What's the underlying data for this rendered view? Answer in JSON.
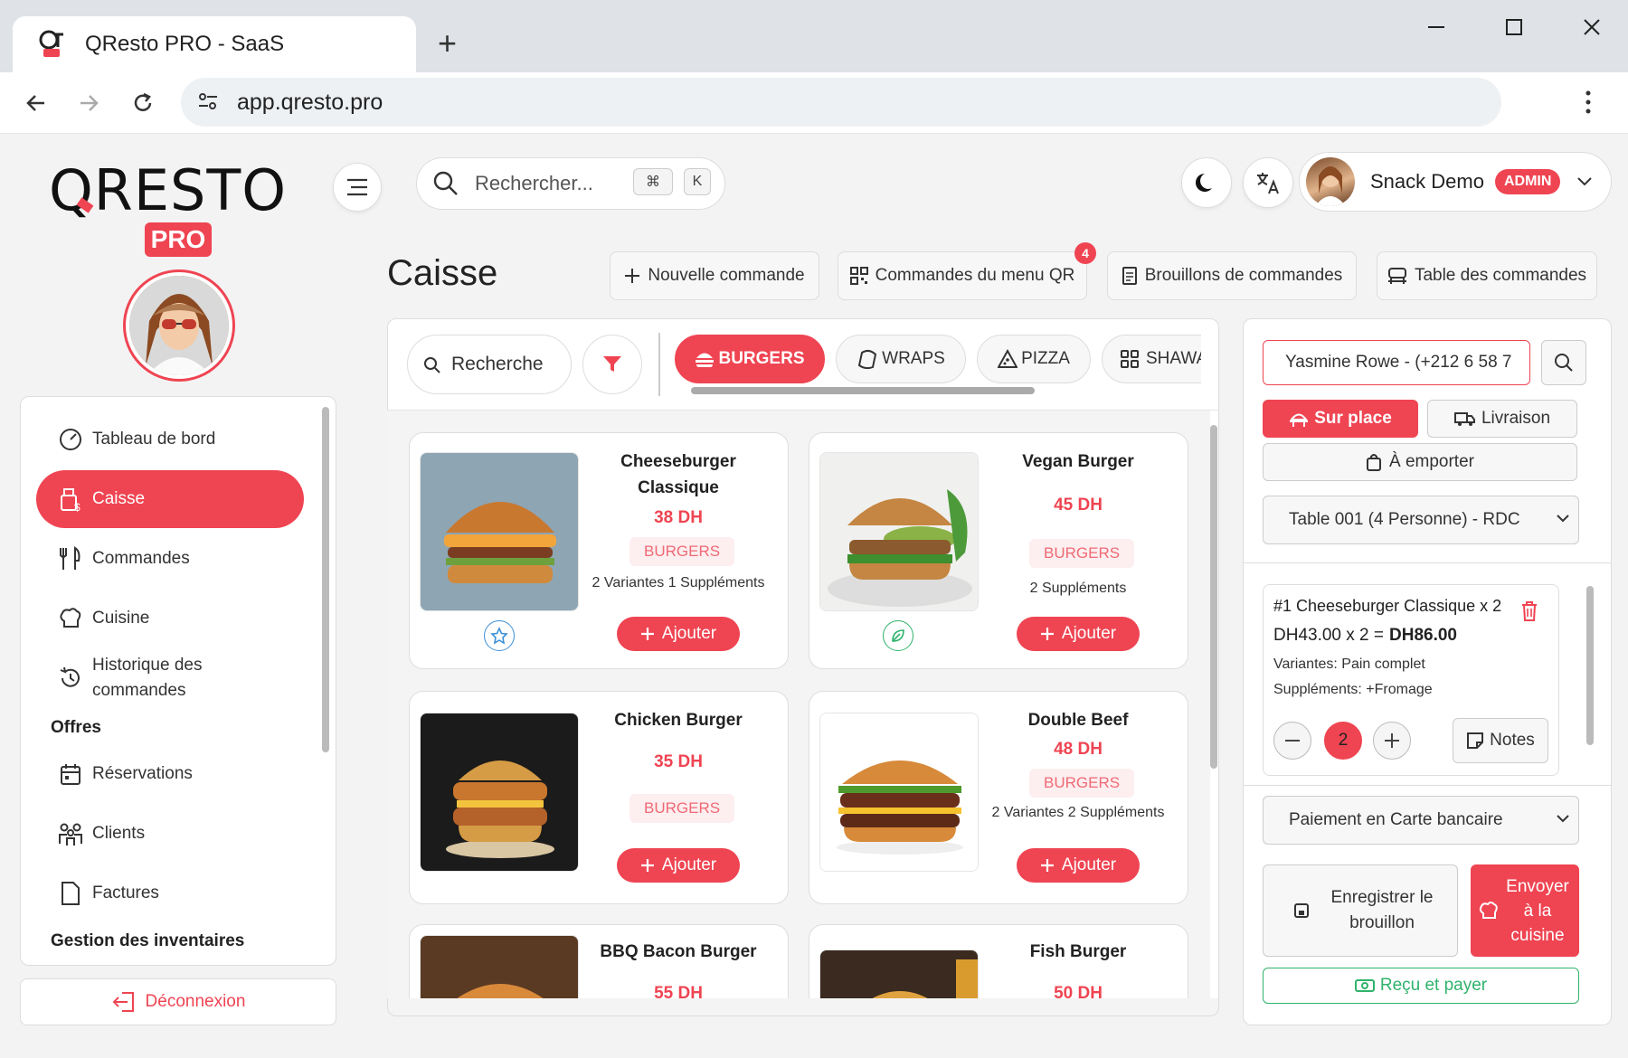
{
  "browser": {
    "tab_title": "QResto PRO - SaaS",
    "url": "app.qresto.pro"
  },
  "header": {
    "logo_text": "QRESTO",
    "logo_badge": "PRO",
    "search_placeholder": "Rechercher...",
    "shortcut_1": "⌘",
    "shortcut_2": "K",
    "user_name": "Snack Demo",
    "user_role": "ADMIN"
  },
  "sidebar": {
    "items": [
      {
        "label": "Tableau de bord",
        "icon": "gauge-icon"
      },
      {
        "label": "Caisse",
        "icon": "cash-register-icon"
      },
      {
        "label": "Commandes",
        "icon": "utensils-icon"
      },
      {
        "label": "Cuisine",
        "icon": "chef-hat-icon"
      },
      {
        "label": "Historique des commandes",
        "icon": "history-icon"
      }
    ],
    "group_offres": "Offres",
    "items2": [
      {
        "label": "Réservations",
        "icon": "calendar-icon"
      },
      {
        "label": "Clients",
        "icon": "users-icon"
      },
      {
        "label": "Factures",
        "icon": "file-icon"
      }
    ],
    "group_inventaires": "Gestion des inventaires",
    "logout": "Déconnexion"
  },
  "page": {
    "title": "Caisse",
    "buttons": {
      "new_order": "Nouvelle commande",
      "qr_orders": "Commandes du menu QR",
      "qr_badge": "4",
      "drafts": "Brouillons de commandes",
      "table_orders": "Table des commandes"
    }
  },
  "products": {
    "search_placeholder": "Recherche",
    "categories": [
      "BURGERS",
      "WRAPS",
      "PIZZA",
      "SHAWARMA"
    ],
    "add_label": "Ajouter",
    "items": [
      {
        "name": "Cheeseburger Classique",
        "price": "38 DH",
        "category": "BURGERS",
        "extras": "2 Variantes 1 Suppléments"
      },
      {
        "name": "Vegan Burger",
        "price": "45 DH",
        "category": "BURGERS",
        "extras": "2 Suppléments"
      },
      {
        "name": "Chicken Burger",
        "price": "35 DH",
        "category": "BURGERS",
        "extras": ""
      },
      {
        "name": "Double Beef",
        "price": "48 DH",
        "category": "BURGERS",
        "extras": "2 Variantes 2 Suppléments"
      },
      {
        "name": "BBQ Bacon Burger",
        "price": "55 DH",
        "category": "",
        "extras": ""
      },
      {
        "name": "Fish Burger",
        "price": "50 DH",
        "category": "",
        "extras": ""
      }
    ]
  },
  "order": {
    "customer": "Yasmine Rowe - (+212 6 58 7",
    "type_dine_in": "Sur place",
    "type_delivery": "Livraison",
    "type_takeaway": "À emporter",
    "table": "Table 001 (4 Personne) - RDC",
    "line": {
      "title": "#1 Cheeseburger Classique x 2",
      "calc": "DH43.00 x 2 =",
      "total": "DH86.00",
      "variants": "Variantes: Pain complet",
      "supplements": "Suppléments: +Fromage",
      "qty": "2",
      "notes": "Notes"
    },
    "payment": "Paiement en Carte bancaire",
    "save_draft": "Enregistrer le brouillon",
    "send_kitchen": "Envoyer à la cuisine",
    "receipt_pay": "Reçu et payer"
  },
  "colors": {
    "accent": "#ef4452",
    "success": "#2fb36b"
  }
}
